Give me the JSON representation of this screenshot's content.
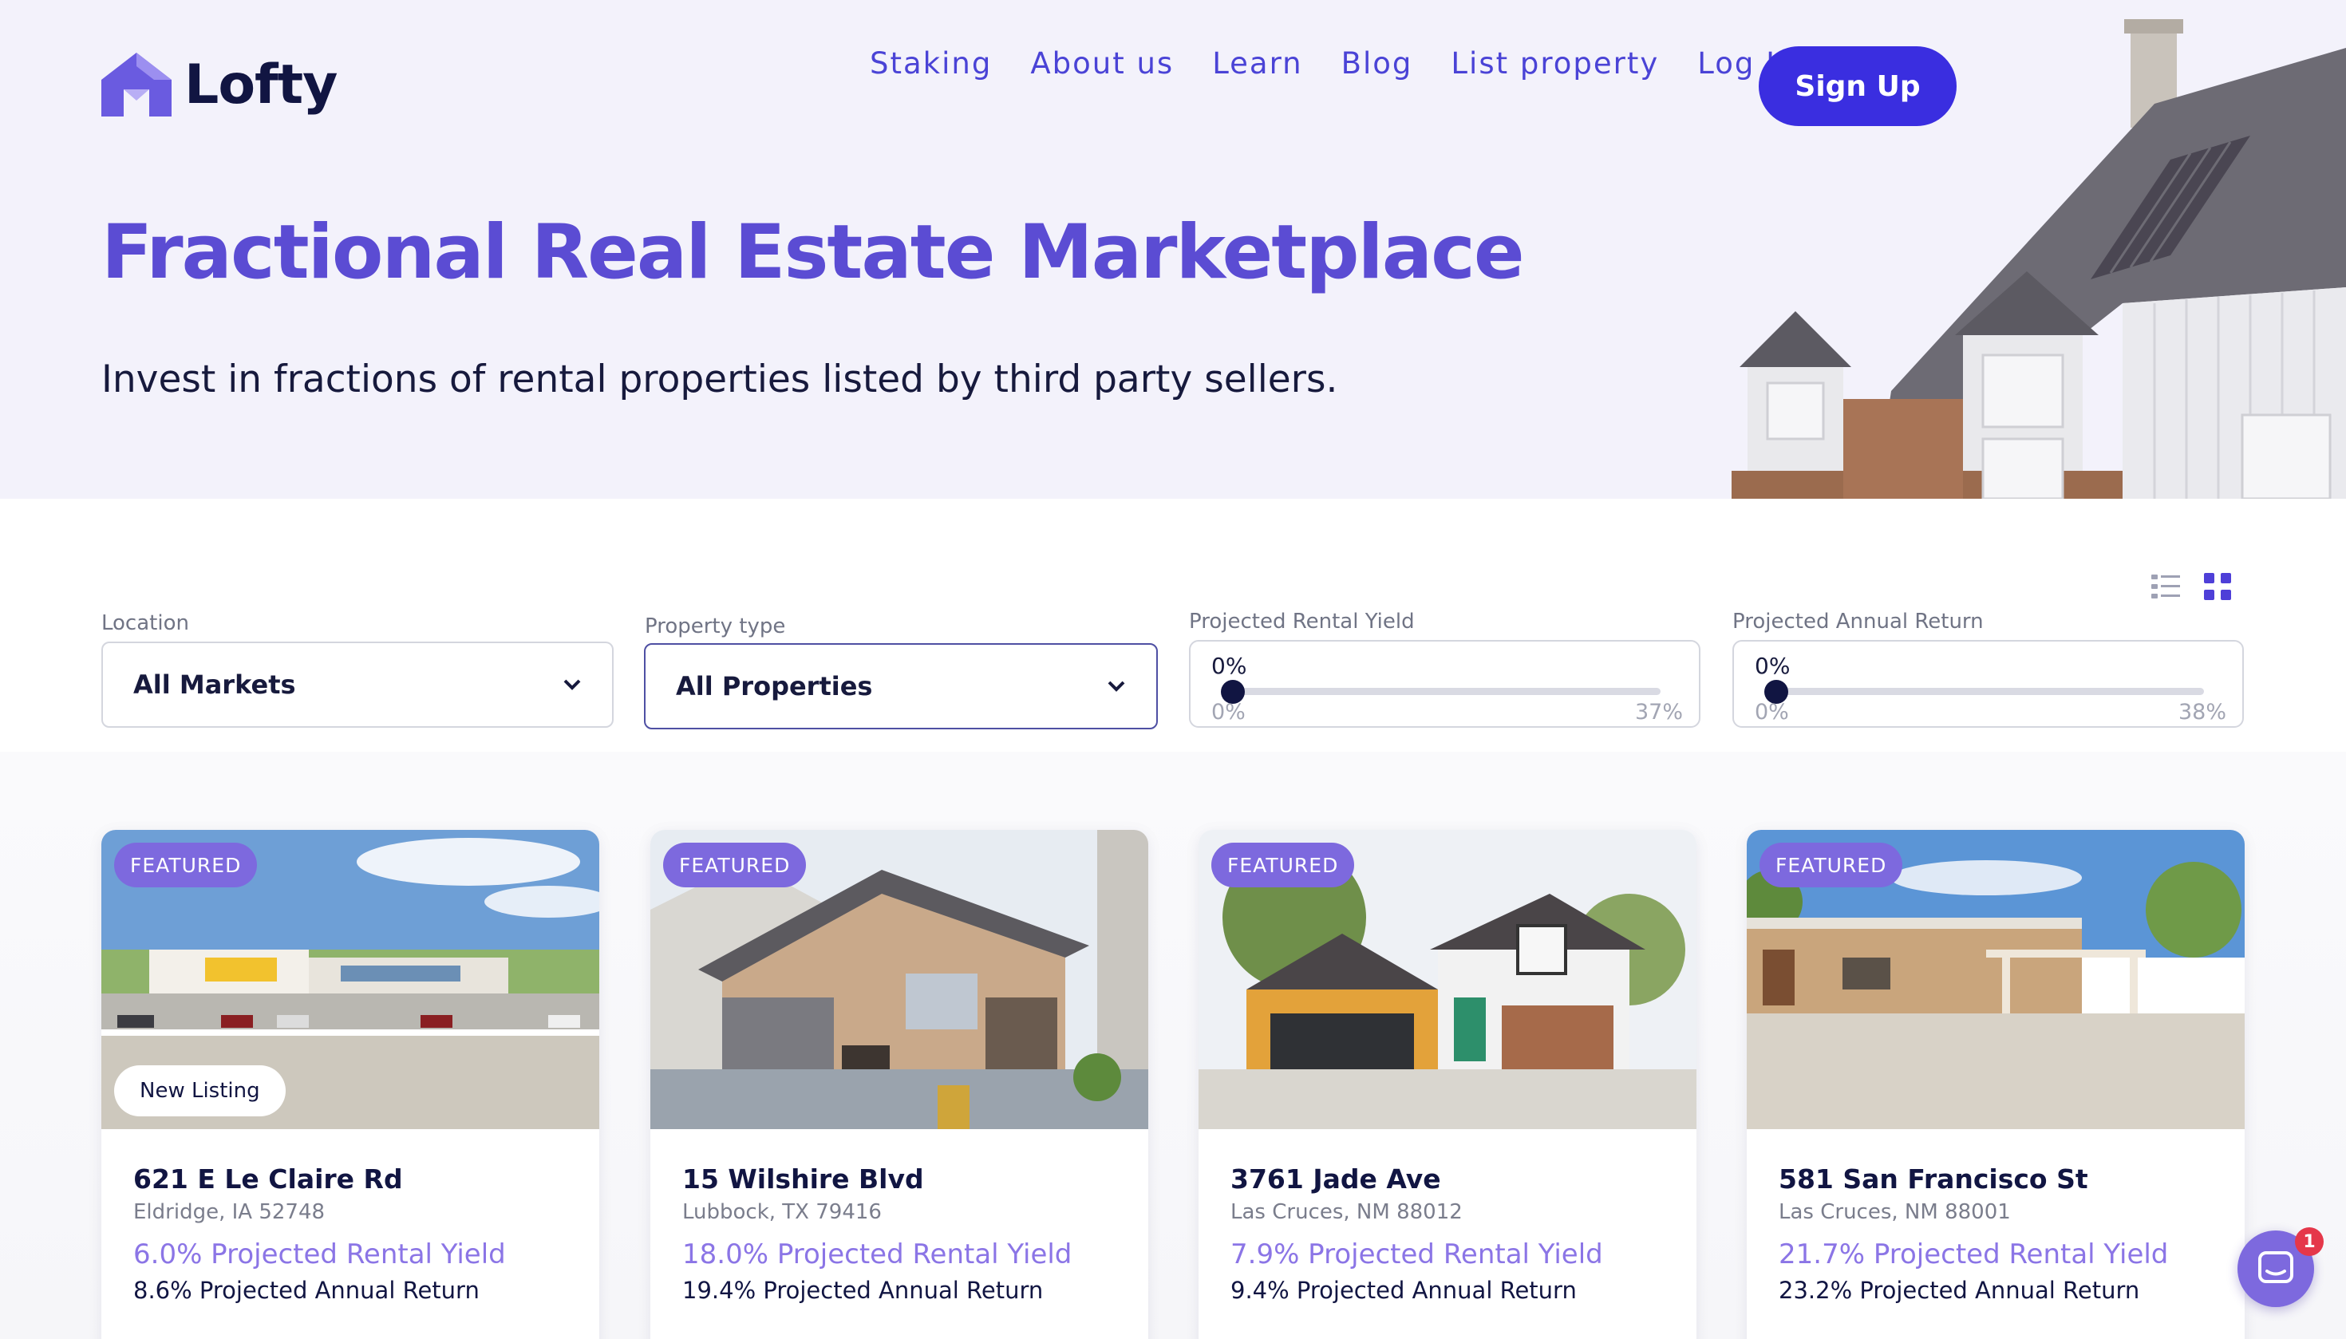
{
  "brand": {
    "name": "Lofty",
    "accent": "#3a2ee0",
    "purple": "#8b75e6"
  },
  "nav": {
    "items": [
      "Staking",
      "About us",
      "Learn",
      "Blog",
      "List property",
      "Log In"
    ],
    "signup": "Sign Up"
  },
  "hero": {
    "title": "Fractional Real Estate Marketplace",
    "subtitle": "Invest in fractions of rental properties listed by third party sellers."
  },
  "filters": {
    "location": {
      "label": "Location",
      "value": "All Markets"
    },
    "property_type": {
      "label": "Property type",
      "value": "All Properties"
    },
    "rental_yield": {
      "label": "Projected Rental Yield",
      "current": "0%",
      "min": "0%",
      "max": "37%"
    },
    "annual_return": {
      "label": "Projected Annual Return",
      "current": "0%",
      "min": "0%",
      "max": "38%"
    },
    "view_icons": [
      "list-view-icon",
      "grid-view-icon"
    ]
  },
  "listings": [
    {
      "badge": "FEATURED",
      "tag": "New Listing",
      "title": "621 E Le Claire Rd",
      "location": "Eldridge, IA 52748",
      "yield": "6.0% Projected Rental Yield",
      "return": "8.6% Projected Annual Return"
    },
    {
      "badge": "FEATURED",
      "title": "15 Wilshire Blvd",
      "location": "Lubbock, TX 79416",
      "yield": "18.0% Projected Rental Yield",
      "return": "19.4% Projected Annual Return"
    },
    {
      "badge": "FEATURED",
      "title": "3761 Jade Ave",
      "location": "Las Cruces, NM 88012",
      "yield": "7.9% Projected Rental Yield",
      "return": "9.4% Projected Annual Return"
    },
    {
      "badge": "FEATURED",
      "title": "581 San Francisco St",
      "location": "Las Cruces, NM 88001",
      "yield": "21.7% Projected Rental Yield",
      "return": "23.2% Projected Annual Return"
    }
  ],
  "chat": {
    "badge_count": "1"
  }
}
